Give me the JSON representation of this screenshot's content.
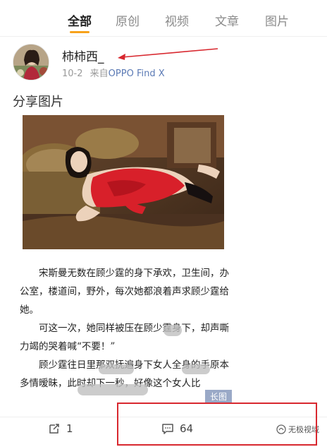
{
  "tabs": [
    {
      "label": "全部",
      "active": true
    },
    {
      "label": "原创",
      "active": false
    },
    {
      "label": "视频",
      "active": false
    },
    {
      "label": "文章",
      "active": false
    },
    {
      "label": "图片",
      "active": false
    }
  ],
  "accent_color": "#f7a21b",
  "annotation_color": "#d8282f",
  "post": {
    "username": "柿柿西_",
    "date": "10-2",
    "source_prefix": "来自",
    "source": "OPPO Find X",
    "title": "分享图片",
    "image_icon": "photo-woman-red-dress",
    "article_paragraphs": [
      "宋斯曼无数在顾少霆的身下承欢，卫生间，办公室，楼道间，野外，每次她都浪着声求顾少霆给她。",
      "可这一次，她同样被压在顾少霆身下，却声嘶力竭的哭着喊“不要！”",
      "顾少霆往日里那双抚遍身下女人全身的手原本多情暧昧，此时却下一秒，好像这个女人比"
    ],
    "long_image_badge": "长图"
  },
  "actions": {
    "repost_count": "1",
    "comment_count": "64"
  },
  "watermark": "无极视域"
}
